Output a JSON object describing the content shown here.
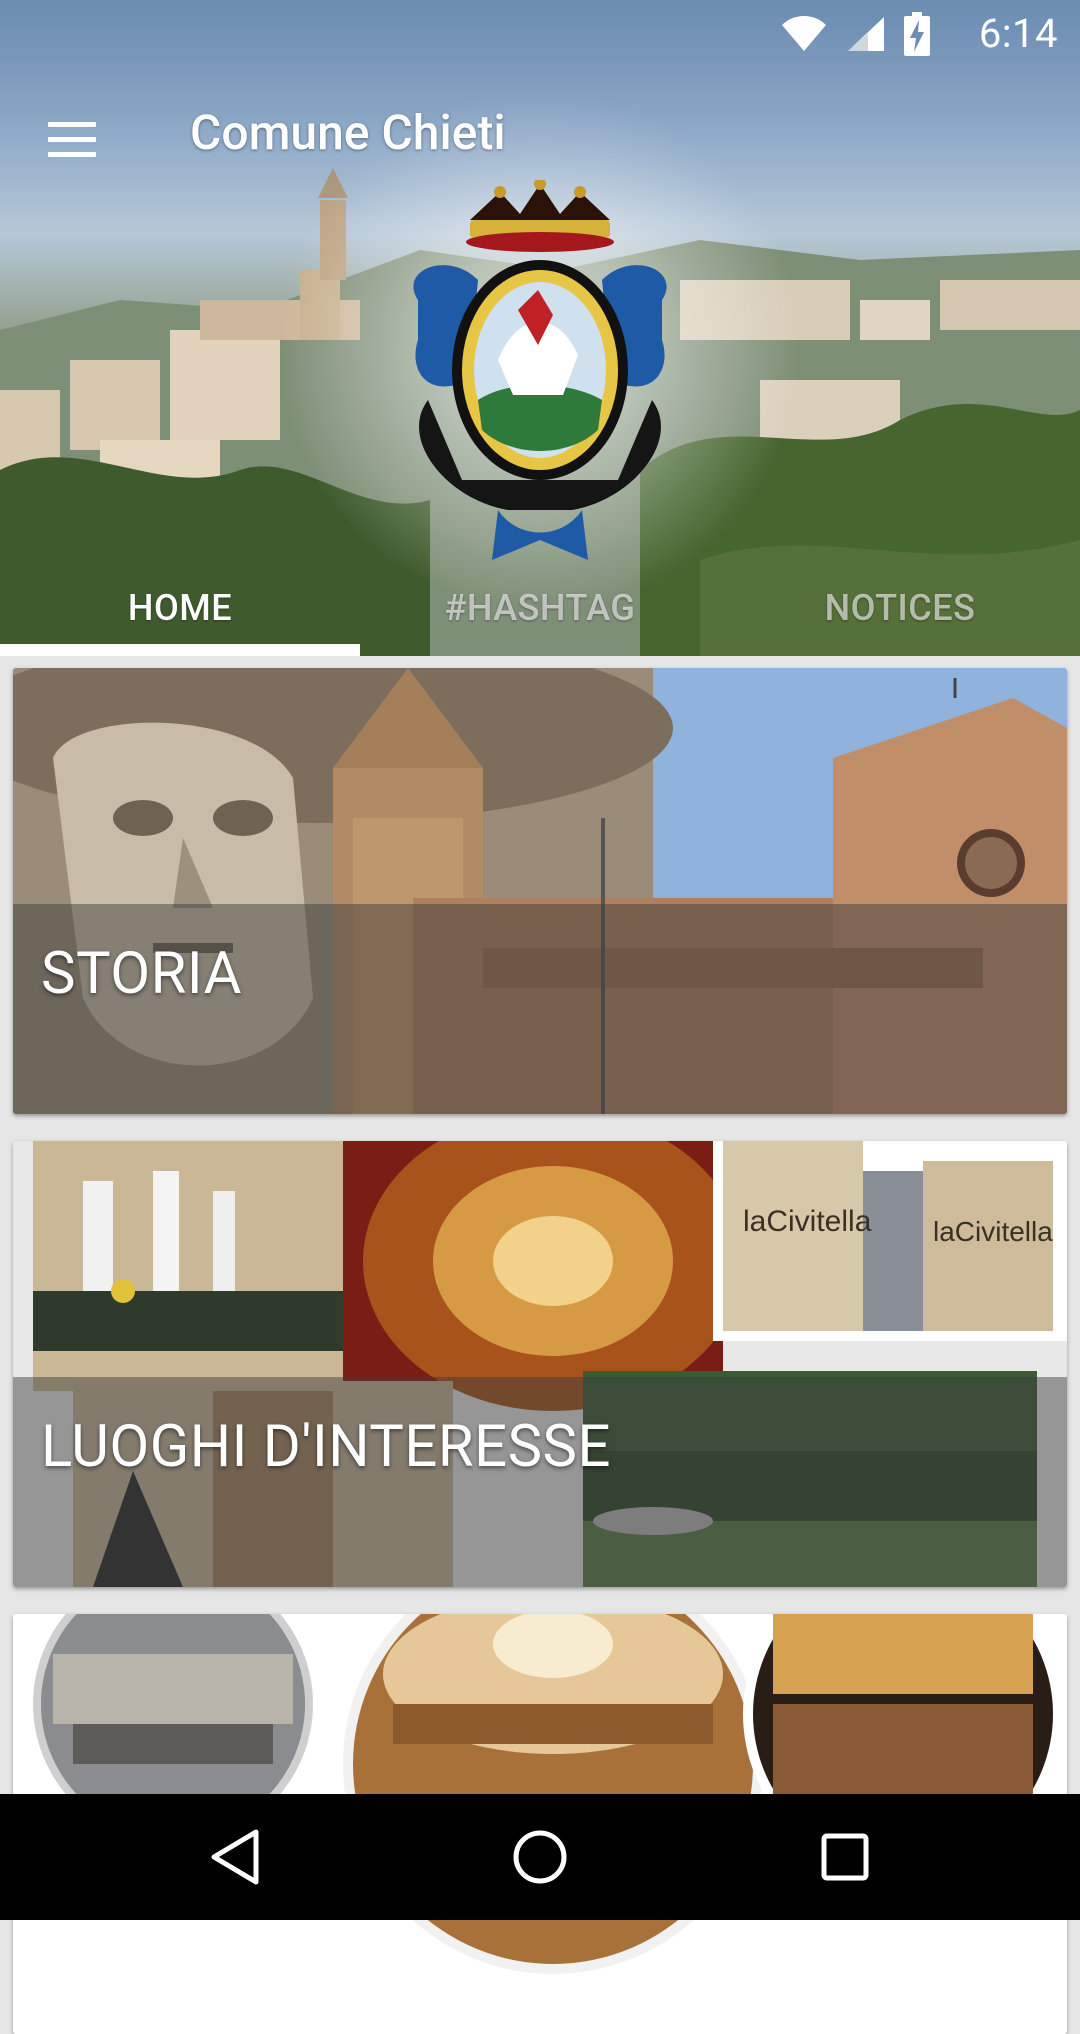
{
  "status": {
    "time": "6:14"
  },
  "app": {
    "title": "Comune Chieti"
  },
  "tabs": [
    {
      "label": "HOME",
      "active": true
    },
    {
      "label": "#HASHTAG",
      "active": false
    },
    {
      "label": "NOTICES",
      "active": false
    }
  ],
  "cards": [
    {
      "label": "STORIA"
    },
    {
      "label": "LUOGHI D'INTERESSE"
    },
    {
      "label": ""
    }
  ],
  "photo_signs": [
    "laCivitella",
    "laCivitella"
  ],
  "icons": {
    "menu": "hamburger-menu-icon",
    "wifi": "wifi-icon",
    "signal": "cell-signal-icon",
    "battery": "battery-charging-icon",
    "back": "back-triangle-icon",
    "home": "home-circle-icon",
    "recents": "recents-square-icon"
  },
  "colors": {
    "tab_active": "#ffffff",
    "tab_inactive": "#d9dde2",
    "navbar": "#000000"
  }
}
